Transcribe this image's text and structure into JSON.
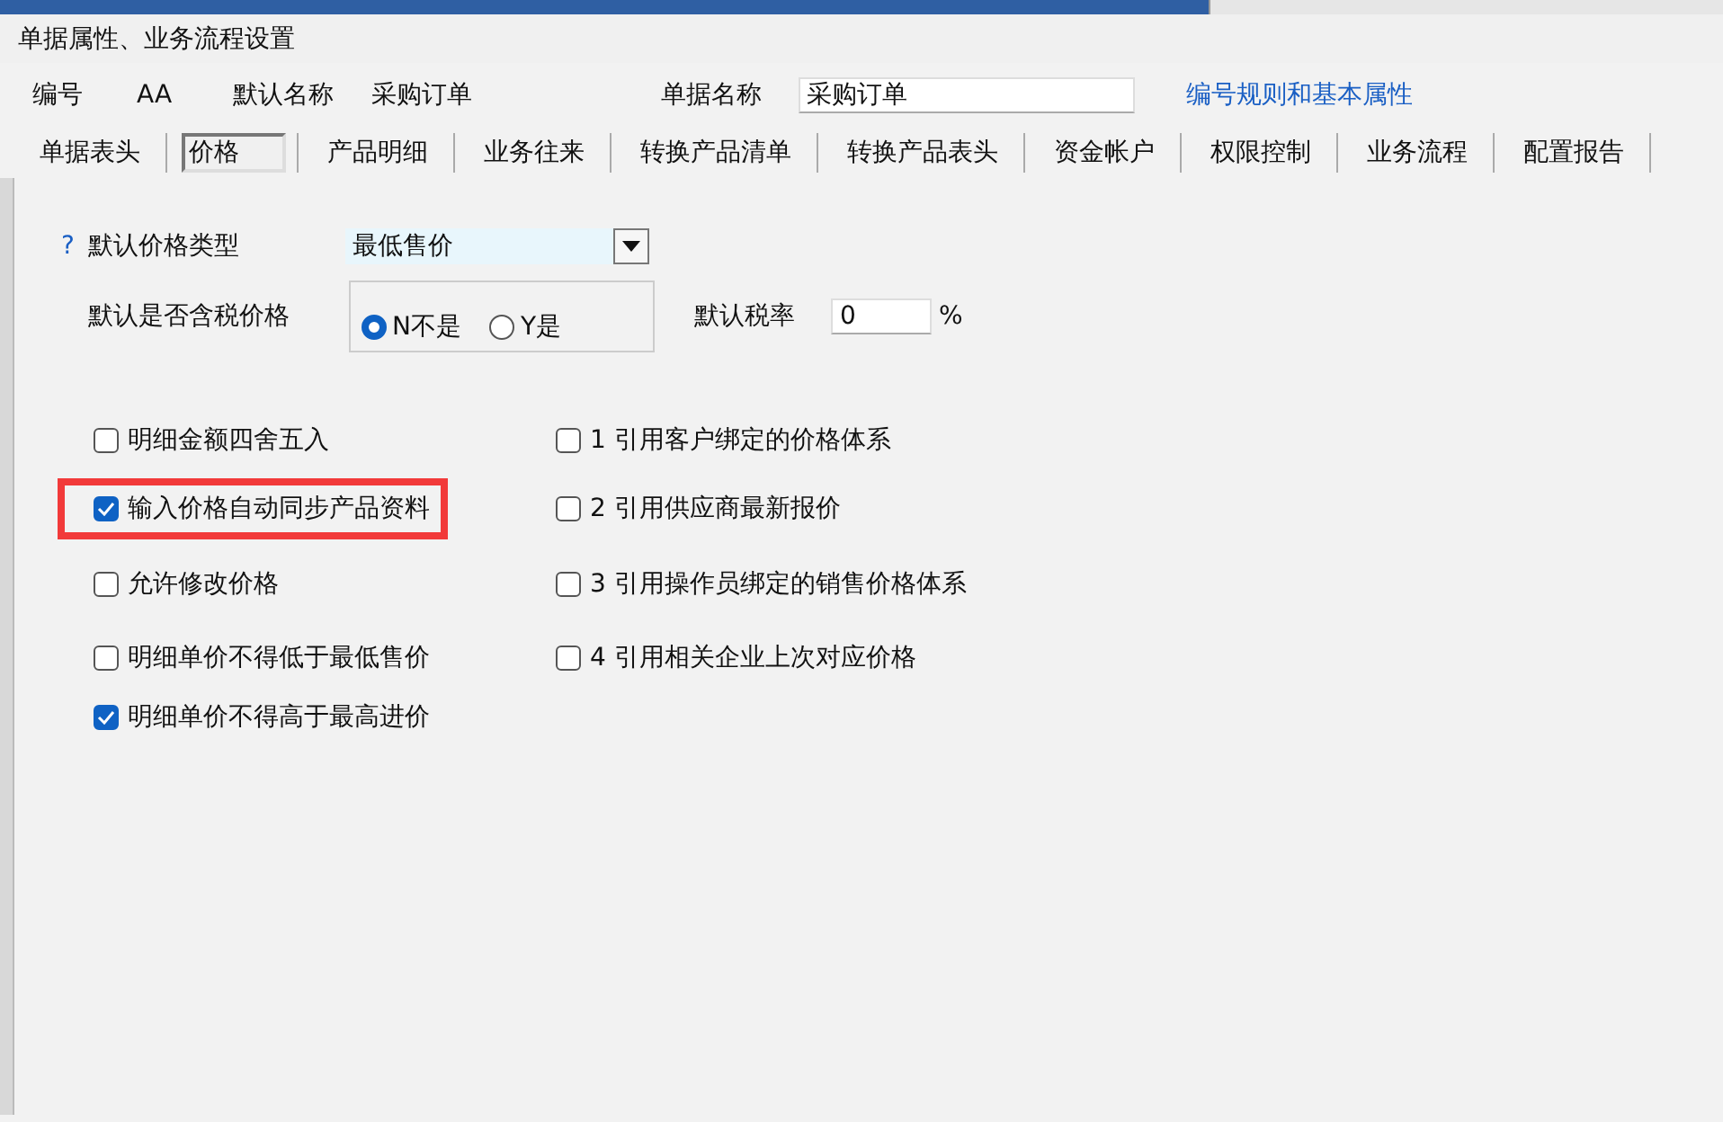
{
  "window": {
    "title": "单据属性、业务流程设置"
  },
  "header": {
    "code_label": "编号",
    "code_value": "AA",
    "default_name_label": "默认名称",
    "default_name_value": "采购订单",
    "doc_name_label": "单据名称",
    "doc_name_value": "采购订单",
    "link": "编号规则和基本属性"
  },
  "tabs": [
    {
      "label": "单据表头",
      "selected": false
    },
    {
      "label": "价格",
      "selected": true
    },
    {
      "label": "产品明细",
      "selected": false
    },
    {
      "label": "业务往来",
      "selected": false
    },
    {
      "label": "转换产品清单",
      "selected": false
    },
    {
      "label": "转换产品表头",
      "selected": false
    },
    {
      "label": "资金帐户",
      "selected": false
    },
    {
      "label": "权限控制",
      "selected": false
    },
    {
      "label": "业务流程",
      "selected": false
    },
    {
      "label": "配置报告",
      "selected": false
    }
  ],
  "price_type": {
    "help": "?",
    "label": "默认价格类型",
    "value": "最低售价"
  },
  "tax_included": {
    "label": "默认是否含税价格",
    "options": [
      {
        "label": "N不是",
        "selected": true
      },
      {
        "label": "Y是",
        "selected": false
      }
    ]
  },
  "tax_rate": {
    "label": "默认税率",
    "value": "0",
    "unit": "%"
  },
  "left_options": [
    {
      "label": "明细金额四舍五入",
      "checked": false,
      "highlighted": false
    },
    {
      "label": "输入价格自动同步产品资料",
      "checked": true,
      "highlighted": true
    },
    {
      "label": "允许修改价格",
      "checked": false,
      "highlighted": false
    },
    {
      "label": "明细单价不得低于最低售价",
      "checked": false,
      "highlighted": false
    },
    {
      "label": "明细单价不得高于最高进价",
      "checked": true,
      "highlighted": false
    }
  ],
  "right_options": [
    {
      "label": "1  引用客户绑定的价格体系",
      "checked": false,
      "highlighted": false
    },
    {
      "label": "2 引用供应商最新报价",
      "checked": false,
      "highlighted": false
    },
    {
      "label": "3 引用操作员绑定的销售价格体系",
      "checked": false,
      "highlighted": false
    },
    {
      "label": "4 引用相关企业上次对应价格",
      "checked": false,
      "highlighted": false
    }
  ]
}
